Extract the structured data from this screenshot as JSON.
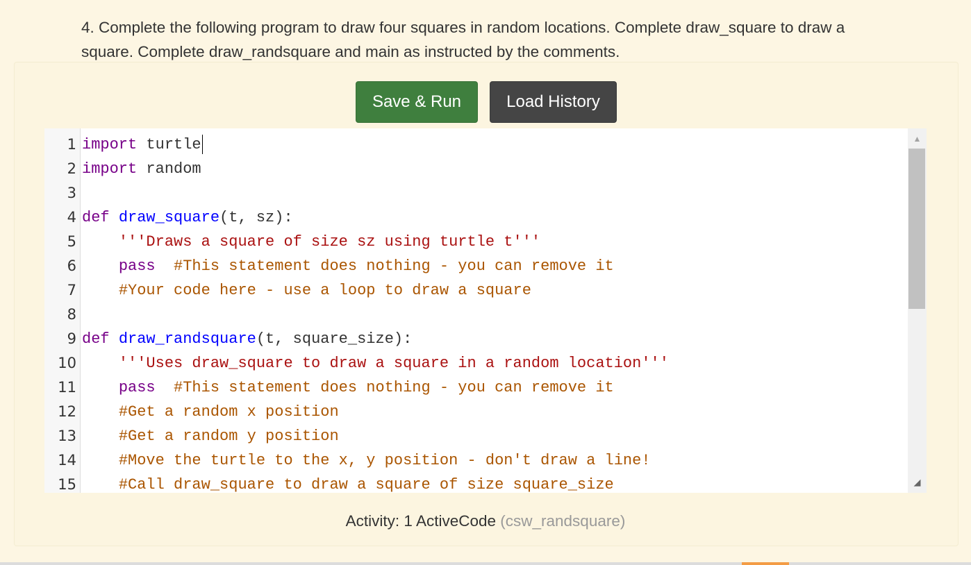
{
  "question": {
    "text": "4. Complete the following program to draw four squares in random locations. Complete draw_square to draw a square. Complete draw_randsquare and main as instructed by the comments."
  },
  "toolbar": {
    "save_run_label": "Save & Run",
    "load_history_label": "Load History"
  },
  "editor": {
    "lines": [
      {
        "n": "1",
        "tokens": [
          {
            "t": "import",
            "c": "kw"
          },
          {
            "t": " turtle",
            "c": ""
          }
        ],
        "cursor": true
      },
      {
        "n": "2",
        "tokens": [
          {
            "t": "import",
            "c": "kw"
          },
          {
            "t": " random",
            "c": ""
          }
        ]
      },
      {
        "n": "3",
        "tokens": []
      },
      {
        "n": "4",
        "tokens": [
          {
            "t": "def",
            "c": "kw"
          },
          {
            "t": " ",
            "c": ""
          },
          {
            "t": "draw_square",
            "c": "def"
          },
          {
            "t": "(t, sz):",
            "c": ""
          }
        ]
      },
      {
        "n": "5",
        "tokens": [
          {
            "t": "    ",
            "c": ""
          },
          {
            "t": "'''Draws a square of size sz using turtle t'''",
            "c": "str"
          }
        ]
      },
      {
        "n": "6",
        "tokens": [
          {
            "t": "    ",
            "c": ""
          },
          {
            "t": "pass",
            "c": "kw"
          },
          {
            "t": "  ",
            "c": ""
          },
          {
            "t": "#This statement does nothing - you can remove it",
            "c": "cmt"
          }
        ]
      },
      {
        "n": "7",
        "tokens": [
          {
            "t": "    ",
            "c": ""
          },
          {
            "t": "#Your code here - use a loop to draw a square",
            "c": "cmt"
          }
        ]
      },
      {
        "n": "8",
        "tokens": []
      },
      {
        "n": "9",
        "tokens": [
          {
            "t": "def",
            "c": "kw"
          },
          {
            "t": " ",
            "c": ""
          },
          {
            "t": "draw_randsquare",
            "c": "def"
          },
          {
            "t": "(t, square_size):",
            "c": ""
          }
        ]
      },
      {
        "n": "10",
        "tokens": [
          {
            "t": "    ",
            "c": ""
          },
          {
            "t": "'''Uses draw_square to draw a square in a random location'''",
            "c": "str"
          }
        ]
      },
      {
        "n": "11",
        "tokens": [
          {
            "t": "    ",
            "c": ""
          },
          {
            "t": "pass",
            "c": "kw"
          },
          {
            "t": "  ",
            "c": ""
          },
          {
            "t": "#This statement does nothing - you can remove it",
            "c": "cmt"
          }
        ]
      },
      {
        "n": "12",
        "tokens": [
          {
            "t": "    ",
            "c": ""
          },
          {
            "t": "#Get a random x position",
            "c": "cmt"
          }
        ]
      },
      {
        "n": "13",
        "tokens": [
          {
            "t": "    ",
            "c": ""
          },
          {
            "t": "#Get a random y position",
            "c": "cmt"
          }
        ]
      },
      {
        "n": "14",
        "tokens": [
          {
            "t": "    ",
            "c": ""
          },
          {
            "t": "#Move the turtle to the x, y position - don't draw a line!",
            "c": "cmt"
          }
        ]
      },
      {
        "n": "15",
        "tokens": [
          {
            "t": "    ",
            "c": ""
          },
          {
            "t": "#Call draw_square to draw a square of size square_size",
            "c": "cmt"
          }
        ]
      }
    ]
  },
  "caption": {
    "label": "Activity: 1 ActiveCode",
    "id": "(csw_randsquare)"
  },
  "colors": {
    "page_bg": "#fdf6e3",
    "run_button": "#3f7f3e",
    "history_button": "#454545",
    "keyword": "#770088",
    "function_name": "#0000ff",
    "string": "#aa1111",
    "comment": "#aa5500"
  },
  "icons": {
    "scroll_up": "triangle-up-icon",
    "resize_grip": "resize-grip-icon"
  }
}
